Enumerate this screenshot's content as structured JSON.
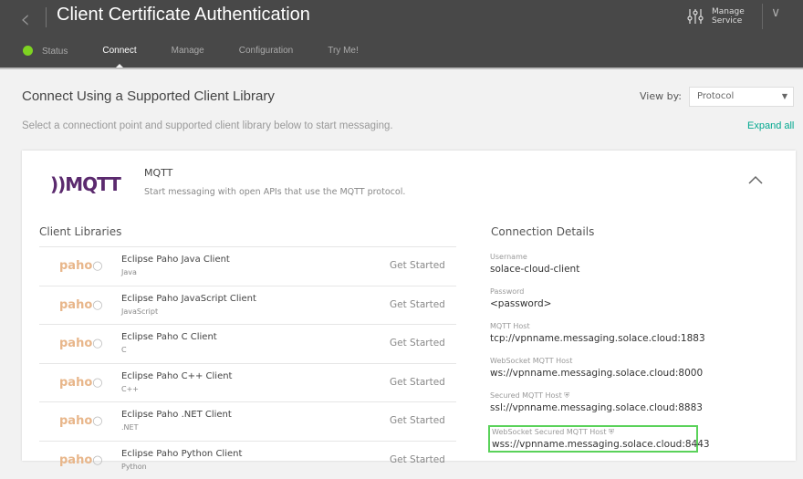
{
  "header": {
    "title": "Client Certificate Authentication",
    "manage_line1": "Manage",
    "manage_line2": "Service"
  },
  "tabs": [
    {
      "label": "Status"
    },
    {
      "label": "Connect"
    },
    {
      "label": "Manage"
    },
    {
      "label": "Configuration"
    },
    {
      "label": "Try Me!"
    }
  ],
  "colors": {
    "status": "#7ed321",
    "accent": "#00a88f",
    "highlight": "#5ad25a"
  },
  "main": {
    "title": "Connect Using a Supported Client Library",
    "view_by_label": "View by:",
    "view_by_value": "Protocol",
    "subtitle": "Select a connectiont point and supported client library below to start messaging.",
    "expand_all": "Expand all"
  },
  "protocol": {
    "logo": "MQTT",
    "name": "MQTT",
    "description": "Start messaging with open APIs that use the MQTT protocol."
  },
  "libraries": {
    "heading": "Client Libraries",
    "logo": "paho",
    "action": "Get Started",
    "items": [
      {
        "name": "Eclipse Paho Java Client",
        "lang": "Java"
      },
      {
        "name": "Eclipse Paho JavaScript Client",
        "lang": "JavaScript"
      },
      {
        "name": "Eclipse Paho C Client",
        "lang": "C"
      },
      {
        "name": "Eclipse Paho C++ Client",
        "lang": "C++"
      },
      {
        "name": "Eclipse Paho .NET Client",
        "lang": ".NET"
      },
      {
        "name": "Eclipse Paho Python Client",
        "lang": "Python"
      }
    ]
  },
  "connection": {
    "heading": "Connection Details",
    "fields": [
      {
        "label": "Username",
        "value": "solace-cloud-client"
      },
      {
        "label": "Password",
        "value": "<password>"
      },
      {
        "label": "MQTT Host",
        "value": "tcp://vpnname.messaging.solace.cloud:1883"
      },
      {
        "label": "WebSocket MQTT Host",
        "value": "ws://vpnname.messaging.solace.cloud:8000"
      },
      {
        "label": "Secured MQTT Host",
        "value": "ssl://vpnname.messaging.solace.cloud:8883"
      },
      {
        "label": "WebSocket Secured MQTT Host",
        "value": "wss://vpnname.messaging.solace.cloud:8443"
      }
    ]
  }
}
